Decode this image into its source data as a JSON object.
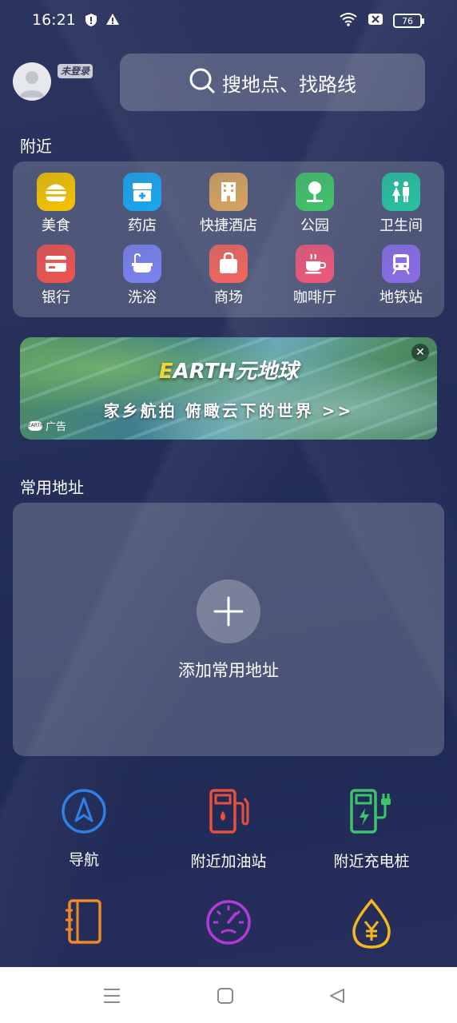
{
  "status_bar": {
    "time": "16:21",
    "battery": "76"
  },
  "header": {
    "login_badge": "未登录",
    "search_placeholder": "搜地点、找路线"
  },
  "nearby": {
    "title": "附近",
    "items": [
      {
        "label": "美食",
        "icon": "burger-icon",
        "color": "#f5c400"
      },
      {
        "label": "药店",
        "icon": "pharmacy-icon",
        "color": "#1aa7ef"
      },
      {
        "label": "快捷酒店",
        "icon": "hotel-icon",
        "color": "#d7a45f"
      },
      {
        "label": "公园",
        "icon": "tree-icon",
        "color": "#3fc46a"
      },
      {
        "label": "卫生间",
        "icon": "restroom-icon",
        "color": "#27c3a0"
      },
      {
        "label": "银行",
        "icon": "card-icon",
        "color": "#f0544f"
      },
      {
        "label": "洗浴",
        "icon": "bathtub-icon",
        "color": "#7b83f0"
      },
      {
        "label": "商场",
        "icon": "shopping-bag-icon",
        "color": "#f2675d"
      },
      {
        "label": "咖啡厅",
        "icon": "coffee-icon",
        "color": "#f0587a"
      },
      {
        "label": "地铁站",
        "icon": "subway-icon",
        "color": "#8a6ee8"
      }
    ]
  },
  "ad": {
    "title_e": "E",
    "title_rest": "ARTH元地球",
    "subtitle": "家乡航拍 俯瞰云下的世界 >>",
    "tag": "广告",
    "close": "✕"
  },
  "frequent": {
    "title": "常用地址",
    "add_label": "添加常用地址"
  },
  "tools": [
    {
      "label": "导航",
      "icon": "navigation-icon",
      "color": "#2f7fe6"
    },
    {
      "label": "附近加油站",
      "icon": "gas-station-icon",
      "color": "#e8503c"
    },
    {
      "label": "附近充电桩",
      "icon": "charging-station-icon",
      "color": "#3cc46a"
    },
    {
      "label": "",
      "icon": "notebook-icon",
      "color": "#f08a24"
    },
    {
      "label": "",
      "icon": "speedometer-icon",
      "color": "#b23ad8"
    },
    {
      "label": "",
      "icon": "yuan-drop-icon",
      "color": "#f2b91e"
    }
  ]
}
